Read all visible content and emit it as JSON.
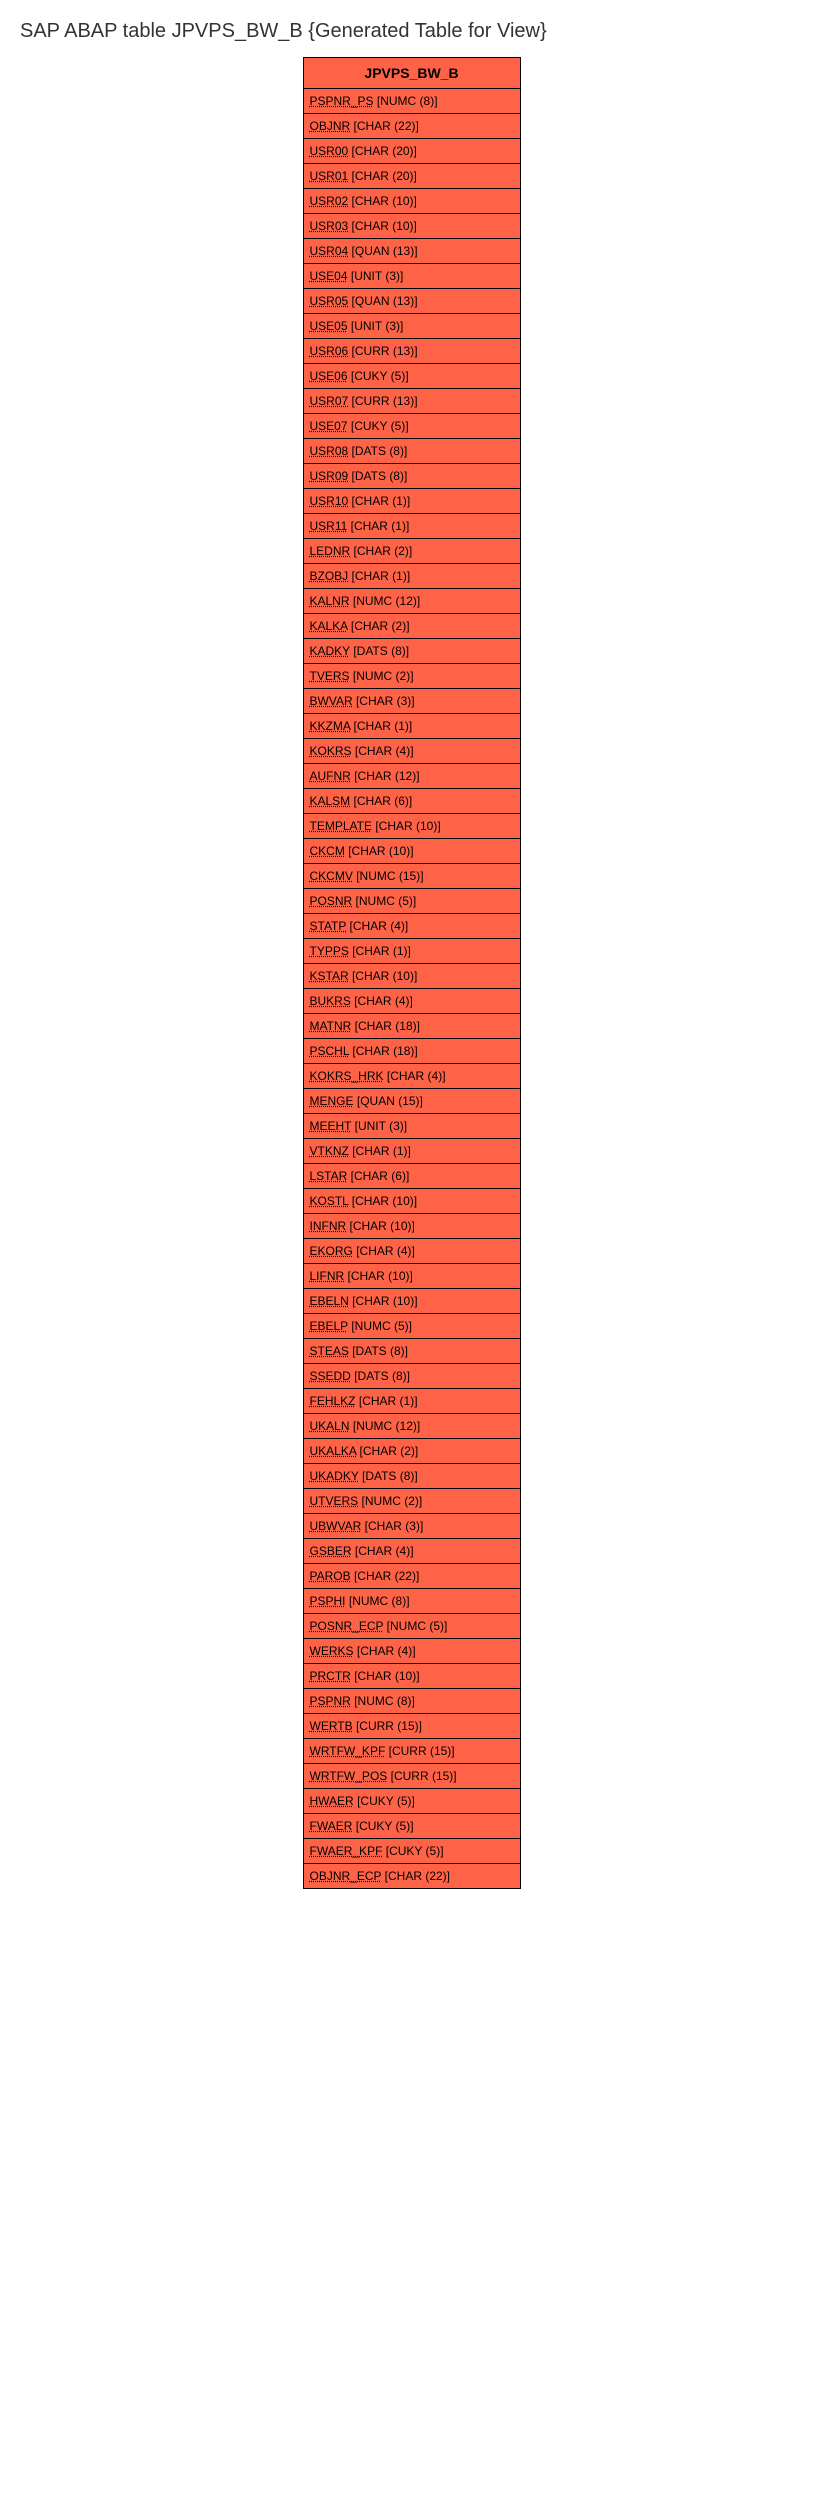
{
  "page_title": "SAP ABAP table JPVPS_BW_B {Generated Table for View}",
  "table_header": "JPVPS_BW_B",
  "fields": [
    {
      "name": "PSPNR_PS",
      "type": "[NUMC (8)]"
    },
    {
      "name": "OBJNR",
      "type": "[CHAR (22)]"
    },
    {
      "name": "USR00",
      "type": "[CHAR (20)]"
    },
    {
      "name": "USR01",
      "type": "[CHAR (20)]"
    },
    {
      "name": "USR02",
      "type": "[CHAR (10)]"
    },
    {
      "name": "USR03",
      "type": "[CHAR (10)]"
    },
    {
      "name": "USR04",
      "type": "[QUAN (13)]"
    },
    {
      "name": "USE04",
      "type": "[UNIT (3)]"
    },
    {
      "name": "USR05",
      "type": "[QUAN (13)]"
    },
    {
      "name": "USE05",
      "type": "[UNIT (3)]"
    },
    {
      "name": "USR06",
      "type": "[CURR (13)]"
    },
    {
      "name": "USE06",
      "type": "[CUKY (5)]"
    },
    {
      "name": "USR07",
      "type": "[CURR (13)]"
    },
    {
      "name": "USE07",
      "type": "[CUKY (5)]"
    },
    {
      "name": "USR08",
      "type": "[DATS (8)]"
    },
    {
      "name": "USR09",
      "type": "[DATS (8)]"
    },
    {
      "name": "USR10",
      "type": "[CHAR (1)]"
    },
    {
      "name": "USR11",
      "type": "[CHAR (1)]"
    },
    {
      "name": "LEDNR",
      "type": "[CHAR (2)]"
    },
    {
      "name": "BZOBJ",
      "type": "[CHAR (1)]"
    },
    {
      "name": "KALNR",
      "type": "[NUMC (12)]"
    },
    {
      "name": "KALKA",
      "type": "[CHAR (2)]"
    },
    {
      "name": "KADKY",
      "type": "[DATS (8)]"
    },
    {
      "name": "TVERS",
      "type": "[NUMC (2)]"
    },
    {
      "name": "BWVAR",
      "type": "[CHAR (3)]"
    },
    {
      "name": "KKZMA",
      "type": "[CHAR (1)]"
    },
    {
      "name": "KOKRS",
      "type": "[CHAR (4)]"
    },
    {
      "name": "AUFNR",
      "type": "[CHAR (12)]"
    },
    {
      "name": "KALSM",
      "type": "[CHAR (6)]"
    },
    {
      "name": "TEMPLATE",
      "type": "[CHAR (10)]"
    },
    {
      "name": "CKCM",
      "type": "[CHAR (10)]"
    },
    {
      "name": "CKCMV",
      "type": "[NUMC (15)]"
    },
    {
      "name": "POSNR",
      "type": "[NUMC (5)]"
    },
    {
      "name": "STATP",
      "type": "[CHAR (4)]"
    },
    {
      "name": "TYPPS",
      "type": "[CHAR (1)]"
    },
    {
      "name": "KSTAR",
      "type": "[CHAR (10)]"
    },
    {
      "name": "BUKRS",
      "type": "[CHAR (4)]"
    },
    {
      "name": "MATNR",
      "type": "[CHAR (18)]"
    },
    {
      "name": "PSCHL",
      "type": "[CHAR (18)]"
    },
    {
      "name": "KOKRS_HRK",
      "type": "[CHAR (4)]"
    },
    {
      "name": "MENGE",
      "type": "[QUAN (15)]"
    },
    {
      "name": "MEEHT",
      "type": "[UNIT (3)]"
    },
    {
      "name": "VTKNZ",
      "type": "[CHAR (1)]"
    },
    {
      "name": "LSTAR",
      "type": "[CHAR (6)]"
    },
    {
      "name": "KOSTL",
      "type": "[CHAR (10)]"
    },
    {
      "name": "INFNR",
      "type": "[CHAR (10)]"
    },
    {
      "name": "EKORG",
      "type": "[CHAR (4)]"
    },
    {
      "name": "LIFNR",
      "type": "[CHAR (10)]"
    },
    {
      "name": "EBELN",
      "type": "[CHAR (10)]"
    },
    {
      "name": "EBELP",
      "type": "[NUMC (5)]"
    },
    {
      "name": "STEAS",
      "type": "[DATS (8)]"
    },
    {
      "name": "SSEDD",
      "type": "[DATS (8)]"
    },
    {
      "name": "FEHLKZ",
      "type": "[CHAR (1)]"
    },
    {
      "name": "UKALN",
      "type": "[NUMC (12)]"
    },
    {
      "name": "UKALKA",
      "type": "[CHAR (2)]"
    },
    {
      "name": "UKADKY",
      "type": "[DATS (8)]"
    },
    {
      "name": "UTVERS",
      "type": "[NUMC (2)]"
    },
    {
      "name": "UBWVAR",
      "type": "[CHAR (3)]"
    },
    {
      "name": "GSBER",
      "type": "[CHAR (4)]"
    },
    {
      "name": "PAROB",
      "type": "[CHAR (22)]"
    },
    {
      "name": "PSPHI",
      "type": "[NUMC (8)]"
    },
    {
      "name": "POSNR_ECP",
      "type": "[NUMC (5)]"
    },
    {
      "name": "WERKS",
      "type": "[CHAR (4)]"
    },
    {
      "name": "PRCTR",
      "type": "[CHAR (10)]"
    },
    {
      "name": "PSPNR",
      "type": "[NUMC (8)]"
    },
    {
      "name": "WERTB",
      "type": "[CURR (15)]"
    },
    {
      "name": "WRTFW_KPF",
      "type": "[CURR (15)]"
    },
    {
      "name": "WRTFW_POS",
      "type": "[CURR (15)]"
    },
    {
      "name": "HWAER",
      "type": "[CUKY (5)]"
    },
    {
      "name": "FWAER",
      "type": "[CUKY (5)]"
    },
    {
      "name": "FWAER_KPF",
      "type": "[CUKY (5)]"
    },
    {
      "name": "OBJNR_ECP",
      "type": "[CHAR (22)]"
    }
  ]
}
